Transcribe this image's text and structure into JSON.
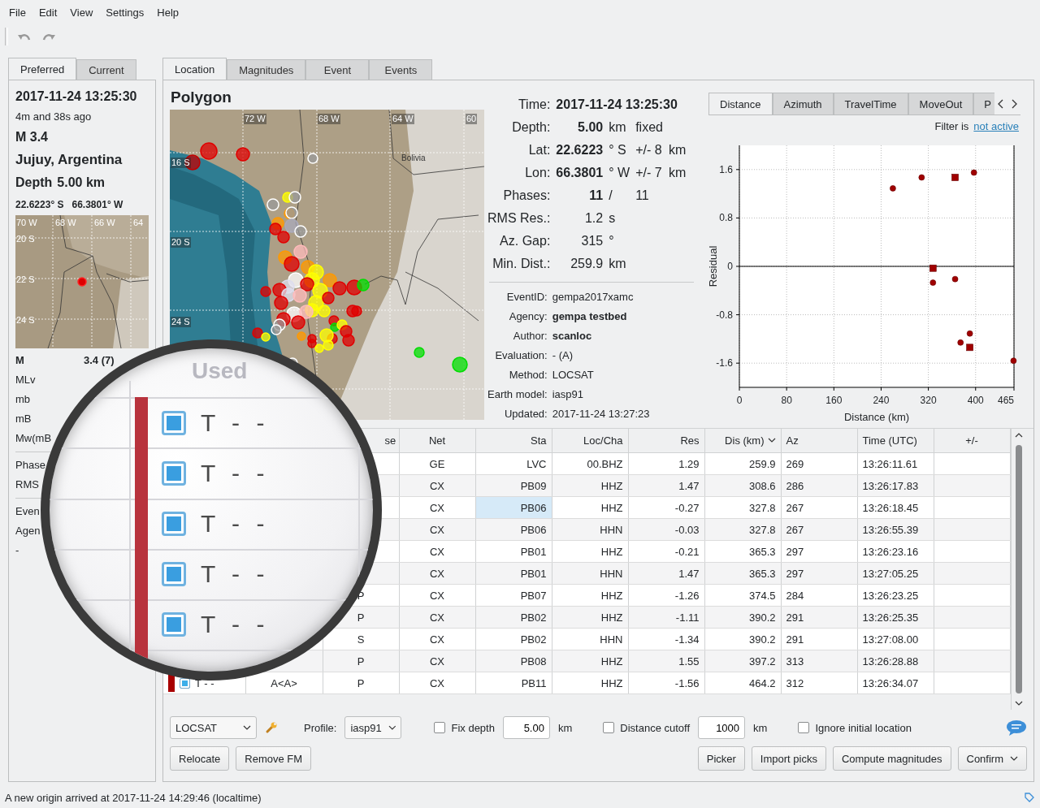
{
  "menu": [
    "File",
    "Edit",
    "View",
    "Settings",
    "Help"
  ],
  "left_panel": {
    "tabs": [
      {
        "label": "Preferred",
        "selected": true
      },
      {
        "label": "Current",
        "selected": false
      }
    ],
    "time": "2017-11-24 13:25:30",
    "ago": "4m and 38s ago",
    "magnitude": "M 3.4",
    "region": "Jujuy, Argentina",
    "depth_label": "Depth",
    "depth": "5.00 km",
    "latitude": "22.6223° S",
    "longitude": "66.3801° W",
    "minimap": {
      "lon_labels": [
        "70 W",
        "68 W",
        "66 W",
        "64"
      ],
      "lat_labels": [
        "20 S",
        "22 S",
        "24 S"
      ]
    },
    "magnitudes": [
      {
        "type": "M",
        "value": "3.4 (7)",
        "preferred": true
      },
      {
        "type": "MLv",
        "preferred": false
      },
      {
        "type": "mb",
        "preferred": false
      },
      {
        "type": "mB",
        "preferred": false
      },
      {
        "type": "Mw(mB",
        "preferred": false
      }
    ],
    "quality": [
      "Phase",
      "RMS"
    ],
    "info": [
      "Even",
      "Agen",
      "-"
    ]
  },
  "main_tabs": [
    {
      "label": "Location",
      "selected": true
    },
    {
      "label": "Magnitudes",
      "selected": false
    },
    {
      "label": "Event",
      "selected": false
    },
    {
      "label": "Events",
      "selected": false
    }
  ],
  "map": {
    "title": "Polygon",
    "lon_labels": [
      "72 W",
      "68 W",
      "64 W",
      "60"
    ],
    "lat_labels": [
      "16 S",
      "20 S",
      "24 S"
    ],
    "country_label": "Bolivia"
  },
  "origin": [
    {
      "label": "Time:",
      "value": "2017-11-24 13:25:30",
      "bold": true,
      "kind": "wide"
    },
    {
      "label": "Depth:",
      "value": "5.00",
      "unit": "km",
      "error": "fixed",
      "bold": true,
      "kind": "grid"
    },
    {
      "label": "Lat:",
      "value": "22.6223",
      "unit": "° S",
      "error": "+/- 8",
      "error_unit": "km",
      "bold": true,
      "kind": "grid"
    },
    {
      "label": "Lon:",
      "value": "66.3801",
      "unit": "° W",
      "error": "+/- 7",
      "error_unit": "km",
      "bold": true,
      "kind": "grid"
    },
    {
      "label": "Phases:",
      "value": "11",
      "unit": "/",
      "error": "11",
      "bold": true,
      "kind": "grid"
    },
    {
      "label": "RMS Res.:",
      "value": "1.2",
      "unit": "s",
      "bold": false,
      "kind": "grid"
    },
    {
      "label": "Az. Gap:",
      "value": "315",
      "unit": "°",
      "bold": false,
      "kind": "grid"
    },
    {
      "label": "Min. Dist.:",
      "value": "259.9",
      "unit": "km",
      "bold": false,
      "kind": "grid"
    }
  ],
  "details": [
    {
      "label": "EventID:",
      "value": "gempa2017xamc",
      "bold": false
    },
    {
      "label": "Agency:",
      "value": "gempa testbed",
      "bold": true
    },
    {
      "label": "Author:",
      "value": "scanloc",
      "bold": true
    },
    {
      "label": "Evaluation:",
      "value": "- (A)",
      "bold": false
    },
    {
      "label": "Method:",
      "value": "LOCSAT",
      "bold": false
    },
    {
      "label": "Earth model:",
      "value": "iasp91",
      "bold": false
    },
    {
      "label": "Updated:",
      "value": "2017-11-24 13:27:23",
      "bold": false
    }
  ],
  "residual_plot": {
    "tabs": [
      {
        "label": "Distance",
        "selected": true
      },
      {
        "label": "Azimuth",
        "selected": false
      },
      {
        "label": "TravelTime",
        "selected": false
      },
      {
        "label": "MoveOut",
        "selected": false
      },
      {
        "label": "P",
        "selected": false
      }
    ],
    "filter_label": "Filter is",
    "filter_link": "not active",
    "chart_data": {
      "type": "scatter",
      "xlabel": "Distance (km)",
      "ylabel": "Residual",
      "grid": true,
      "xlim": [
        0,
        465
      ],
      "ylim": [
        -2,
        2
      ],
      "xticks": [
        0,
        80,
        160,
        240,
        320,
        400,
        465
      ],
      "yticks": [
        -1.6,
        -0.8,
        0,
        0.8,
        1.6
      ],
      "series": [
        {
          "marker": "circle",
          "color": "#a00000",
          "x": [
            259.9,
            308.6,
            327.8,
            365.3,
            374.5,
            390.2,
            397.2,
            464.2
          ],
          "values": [
            1.29,
            1.47,
            -0.27,
            -0.21,
            -1.26,
            -1.11,
            1.55,
            -1.56
          ]
        },
        {
          "marker": "square",
          "color": "#a00000",
          "x": [
            327.8,
            365.3,
            390.2
          ],
          "values": [
            -0.03,
            1.47,
            -1.34
          ]
        }
      ]
    }
  },
  "lens": {
    "header": "Used",
    "rows": [
      {
        "checked": true,
        "flags": "T - -"
      },
      {
        "checked": true,
        "flags": "T - -"
      },
      {
        "checked": true,
        "flags": "T - -"
      },
      {
        "checked": true,
        "flags": "T - -"
      },
      {
        "checked": true,
        "flags": "T - -"
      }
    ]
  },
  "table": {
    "columns": [
      "se",
      "Net",
      "Sta",
      "Loc/Cha",
      "Res",
      {
        "label": "Dis (km)",
        "sorted": true
      },
      "Az",
      "Time (UTC)",
      "+/-"
    ],
    "rows": [
      {
        "net": "GE",
        "sta": "LVC",
        "loc_cha": "00.BHZ",
        "res": "1.29",
        "dis": "259.9",
        "az": "269",
        "time": "13:26:11.61",
        "sta_focused": false
      },
      {
        "net": "CX",
        "sta": "PB09",
        "loc_cha": "HHZ",
        "res": "1.47",
        "dis": "308.6",
        "az": "286",
        "time": "13:26:17.83",
        "sta_focused": false
      },
      {
        "net": "CX",
        "sta": "PB06",
        "loc_cha": "HHZ",
        "res": "-0.27",
        "dis": "327.8",
        "az": "267",
        "time": "13:26:18.45",
        "sta_focused": true
      },
      {
        "net": "CX",
        "sta": "PB06",
        "loc_cha": "HHN",
        "res": "-0.03",
        "dis": "327.8",
        "az": "267",
        "time": "13:26:55.39",
        "sta_focused": false
      },
      {
        "net": "CX",
        "sta": "PB01",
        "loc_cha": "HHZ",
        "res": "-0.21",
        "dis": "365.3",
        "az": "297",
        "time": "13:26:23.16",
        "sta_focused": false
      },
      {
        "net": "CX",
        "sta": "PB01",
        "loc_cha": "HHN",
        "res": "1.47",
        "dis": "365.3",
        "az": "297",
        "time": "13:27:05.25",
        "sta_focused": false
      },
      {
        "phase": "P",
        "net": "CX",
        "sta": "PB07",
        "loc_cha": "HHZ",
        "res": "-1.26",
        "dis": "374.5",
        "az": "284",
        "time": "13:26:23.25",
        "sta_focused": false
      },
      {
        "phase": "P",
        "net": "CX",
        "sta": "PB02",
        "loc_cha": "HHZ",
        "res": "-1.11",
        "dis": "390.2",
        "az": "291",
        "time": "13:26:25.35",
        "sta_focused": false
      },
      {
        "phase": "S",
        "net": "CX",
        "sta": "PB02",
        "loc_cha": "HHN",
        "res": "-1.34",
        "dis": "390.2",
        "az": "291",
        "time": "13:27:08.00",
        "sta_focused": false
      },
      {
        "phase": "P",
        "net": "CX",
        "sta": "PB08",
        "loc_cha": "HHZ",
        "res": "1.55",
        "dis": "397.2",
        "az": "313",
        "time": "13:26:28.88",
        "sta_focused": false
      },
      {
        "used": {
          "checked": true,
          "flags": "T - -"
        },
        "method": "A<A>",
        "phase": "P",
        "net": "CX",
        "sta": "PB11",
        "loc_cha": "HHZ",
        "res": "-1.56",
        "dis": "464.2",
        "az": "312",
        "time": "13:26:34.07",
        "sta_focused": false
      }
    ]
  },
  "controls": {
    "locator": "LOCSAT",
    "profile_label": "Profile:",
    "profile": "iasp91",
    "fix_depth": {
      "label": "Fix depth",
      "checked": false
    },
    "depth_value": "5.00",
    "depth_unit": "km",
    "distance_cutoff": {
      "label": "Distance cutoff",
      "checked": false
    },
    "cutoff_value": "1000",
    "cutoff_unit": "km",
    "ignore_initial": {
      "label": "Ignore initial location",
      "checked": false
    },
    "left_buttons": [
      "Relocate",
      "Remove FM"
    ],
    "right_buttons": [
      "Picker",
      "Import picks",
      "Compute magnitudes"
    ],
    "confirm": "Confirm"
  },
  "status_bar": "A new origin arrived at 2017-11-24 14:29:46 (localtime)"
}
